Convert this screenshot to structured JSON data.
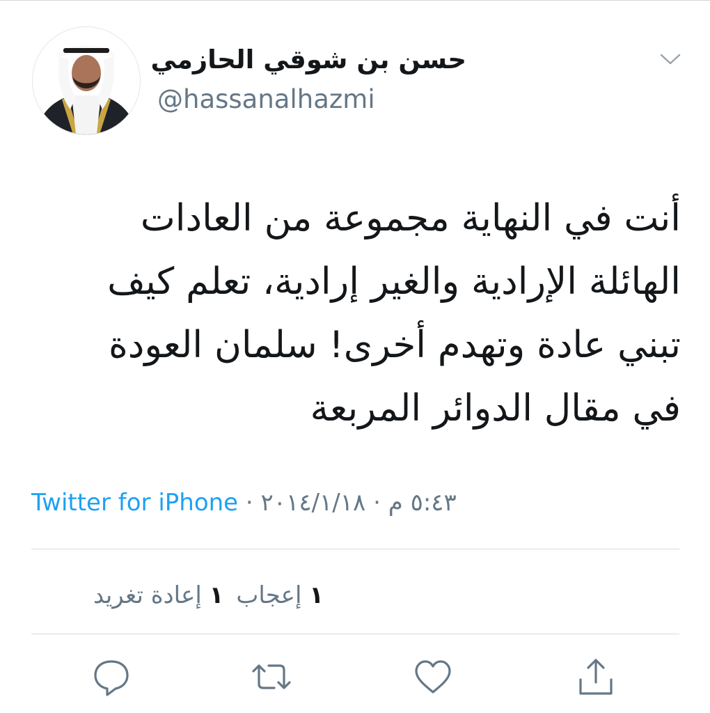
{
  "tweet": {
    "display_name": "حسن بن شوقي الحازمي",
    "handle": "@hassanalhazmi",
    "text_lines": [
      "أنت في النهاية مجموعة من العادات",
      "الهائلة الإرادية والغير إرادية، تعلم كيف",
      "تبني عادة وتهدم أخرى! سلمان العودة",
      "في مقال الدوائر المربعة"
    ],
    "time": "٥:٤٣ م",
    "date": "٢٠١٤/١/١٨",
    "separator": "·",
    "source": "Twitter for iPhone",
    "stats": {
      "likes_count": "١",
      "likes_label": "إعجاب",
      "retweets_count": "١",
      "retweets_label": "إعادة تغريد"
    }
  },
  "icons": {
    "more": "chevron-down-icon",
    "reply": "reply-icon",
    "retweet": "retweet-icon",
    "like": "heart-icon",
    "share": "share-icon"
  },
  "colors": {
    "link": "#1da1f2",
    "secondary_text": "#657786",
    "primary_text": "#14171a",
    "divider": "#dcdcdc"
  }
}
